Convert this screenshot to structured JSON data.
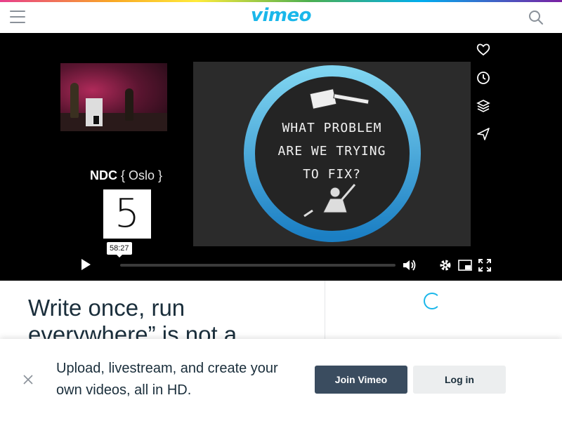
{
  "header": {
    "logo_text": "vimeo",
    "accent_color": "#1ab7ea"
  },
  "player": {
    "ndc_brand": "NDC",
    "ndc_location": "{ Oslo }",
    "ndc_number": "5",
    "slide_lines": [
      "WHAT PROBLEM",
      "ARE WE TRYING",
      "TO FIX?"
    ],
    "timecode": "58:27",
    "side_icons": [
      "heart-icon",
      "clock-icon",
      "layers-icon",
      "share-icon"
    ],
    "control_icons": [
      "play-icon",
      "volume-icon",
      "gear-icon",
      "pip-icon",
      "fullscreen-icon"
    ],
    "progress_fraction": 0.0
  },
  "video": {
    "title": "Write once, run everywhere” is not a"
  },
  "banner": {
    "message": "Upload, livestream, and create your own videos, all in HD.",
    "join_label": "Join Vimeo",
    "login_label": "Log in",
    "join_color": "#3a4c5f"
  }
}
